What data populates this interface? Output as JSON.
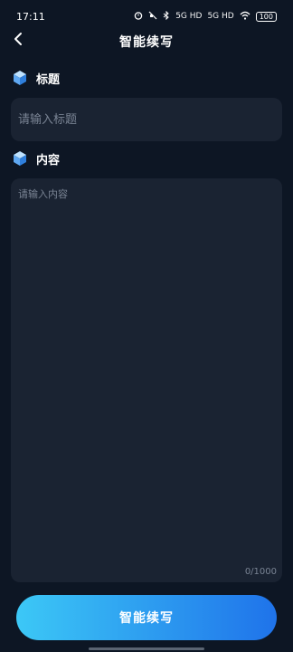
{
  "status_bar": {
    "time": "17:11",
    "network_1": "5G HD",
    "network_2": "5G HD",
    "battery": "100"
  },
  "nav": {
    "title": "智能续写"
  },
  "title_section": {
    "label": "标题",
    "input_value": "",
    "placeholder": "请输入标题"
  },
  "content_section": {
    "label": "内容",
    "input_value": "",
    "placeholder": "请输入内容",
    "char_count": "0/1000"
  },
  "actions": {
    "submit_label": "智能续写"
  },
  "colors": {
    "background": "#0d1624",
    "field_background": "#1a2332",
    "placeholder": "#7a8494",
    "button_gradient_start": "#3cc8f6",
    "button_gradient_end": "#1f73ea"
  }
}
